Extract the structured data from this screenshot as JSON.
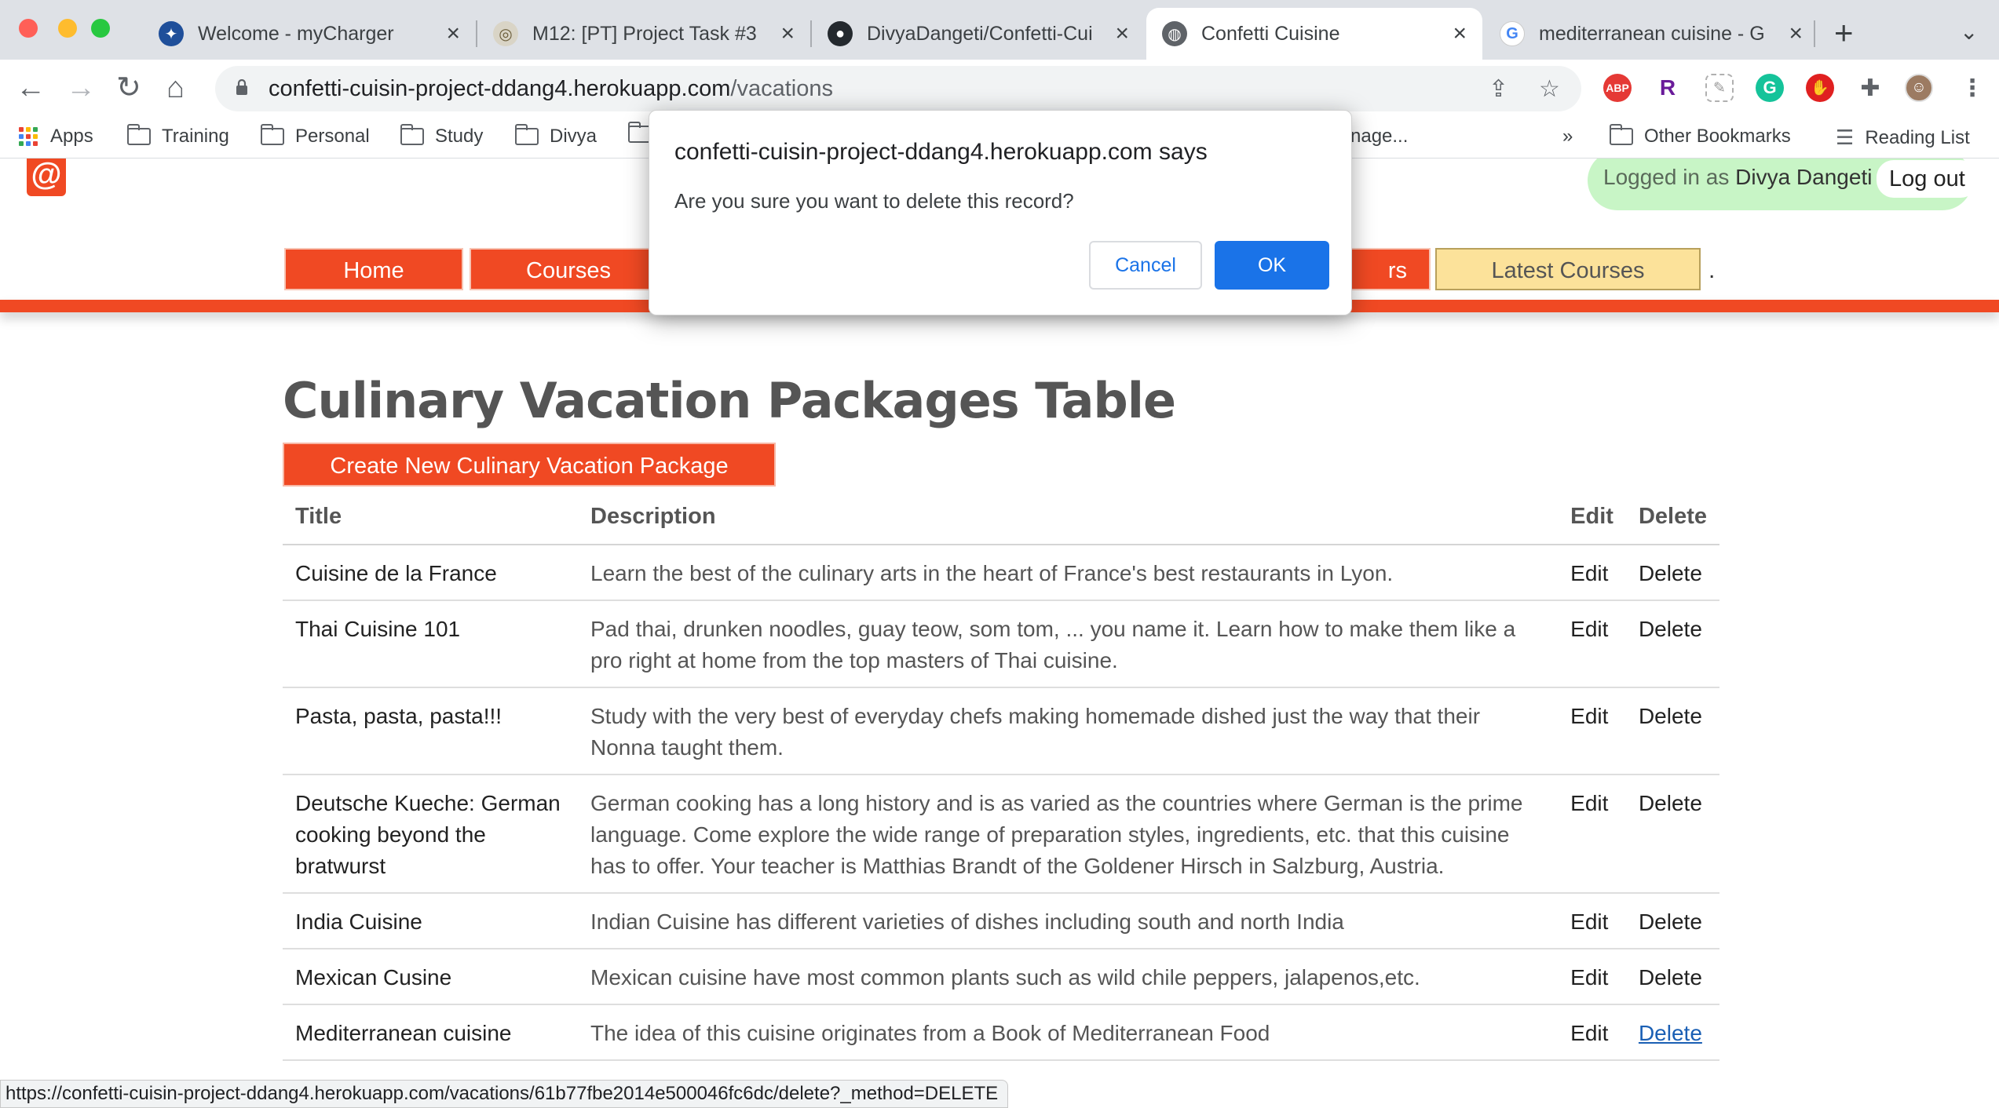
{
  "browser": {
    "tabs": [
      {
        "title": "Welcome - myCharger",
        "icon": "mycharger-icon"
      },
      {
        "title": "M12: [PT] Project Task #3",
        "icon": "canvas-icon"
      },
      {
        "title": "DivyaDangeti/Confetti-Cui",
        "icon": "github-icon"
      },
      {
        "title": "Confetti Cuisine",
        "icon": "globe-icon",
        "active": true
      },
      {
        "title": "mediterranean cuisine - G",
        "icon": "google-icon"
      }
    ],
    "url_host": "confetti-cuisin-project-ddang4.herokuapp.com",
    "url_path": "/vacations",
    "extensions": [
      "ABP",
      "R",
      "G"
    ],
    "bookmarks": {
      "apps": "Apps",
      "folders": [
        "Training",
        "Personal",
        "Study",
        "Divya"
      ],
      "partial": "nage...",
      "overflow": "»",
      "other": "Other Bookmarks",
      "reading_list": "Reading List"
    }
  },
  "site": {
    "logo": "@",
    "login_prefix": "Logged in as",
    "login_user": "Divya Dangeti",
    "logout": "Log out",
    "nav": {
      "home": "Home",
      "courses": "Courses",
      "partial": "rs",
      "latest": "Latest Courses",
      "trailing": "."
    },
    "colors": {
      "brand": "#f04923",
      "highlight": "#fce29a",
      "login_bg": "#c8f5c6",
      "link": "#1a5fb4"
    }
  },
  "main": {
    "title": "Culinary Vacation Packages Table",
    "create_button": "Create New Culinary Vacation Package",
    "table": {
      "headers": [
        "Title",
        "Description",
        "Edit",
        "Delete"
      ],
      "edit_label": "Edit",
      "delete_label": "Delete",
      "rows": [
        {
          "title": "Cuisine de la France",
          "description": "Learn the best of the culinary arts in the heart of France's best restaurants in Lyon."
        },
        {
          "title": "Thai Cuisine 101",
          "description": "Pad thai, drunken noodles, guay teow, som tom, ... you name it. Learn how to make them like a pro right at home from the top masters of Thai cuisine."
        },
        {
          "title": "Pasta, pasta, pasta!!!",
          "description": "Study with the very best of everyday chefs making homemade dished just the way that their Nonna taught them."
        },
        {
          "title": "Deutsche Kueche: German cooking beyond the bratwurst",
          "description": "German cooking has a long history and is as varied as the countries where German is the prime language. Come explore the wide range of preparation styles, ingredients, etc. that this cuisine has to offer. Your teacher is Matthias Brandt of the Goldener Hirsch in Salzburg, Austria."
        },
        {
          "title": "India Cuisine",
          "description": "Indian Cuisine has different varieties of dishes including south and north India"
        },
        {
          "title": "Mexican Cusine",
          "description": "Mexican cuisine have most common plants such as wild chile peppers, jalapenos,etc."
        },
        {
          "title": "Mediterranean cuisine",
          "description": "The idea of this cuisine originates from a Book of Mediterranean Food",
          "delete_hovered": true
        }
      ]
    }
  },
  "status_bar": "https://confetti-cuisin-project-ddang4.herokuapp.com/vacations/61b77fbe2014e500046fc6dc/delete?_method=DELETE",
  "dialog": {
    "title": "confetti-cuisin-project-ddang4.herokuapp.com says",
    "message": "Are you sure you want to delete this record?",
    "cancel": "Cancel",
    "ok": "OK"
  }
}
